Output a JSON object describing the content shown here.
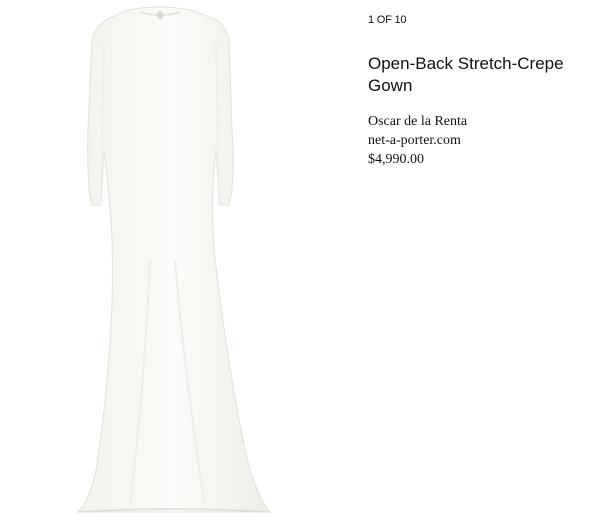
{
  "carousel": {
    "counter": "1 OF 10"
  },
  "product": {
    "title": "Open-Back Stretch-Crepe Gown",
    "designer": "Oscar de la Renta",
    "retailer": "net-a-porter.com",
    "price": "$4,990.00",
    "image_subject": "white long-sleeve open-back gown"
  },
  "colors": {
    "gown": "#f8f7f3",
    "gown_shadow": "#e8e6df",
    "text": "#111111"
  }
}
